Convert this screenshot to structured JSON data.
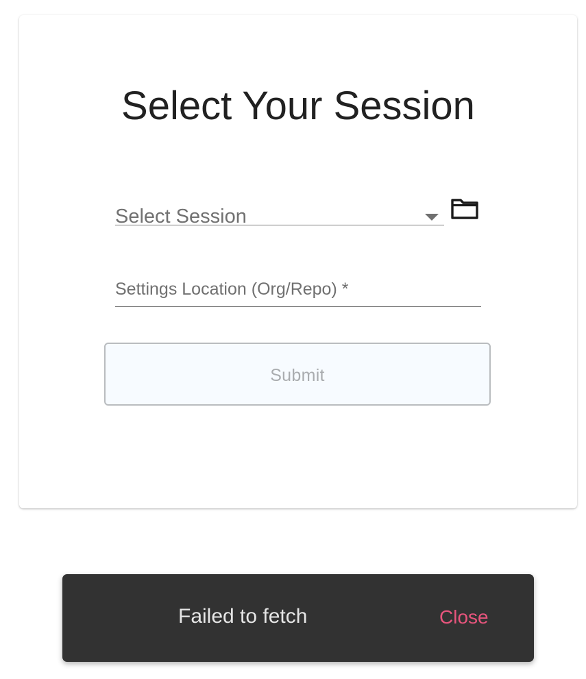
{
  "dialog": {
    "title": "Select Your Session",
    "session_select": {
      "placeholder": "Select Session",
      "icon": "chevron-down-icon"
    },
    "browse_button": {
      "icon": "folder-icon"
    },
    "settings_location": {
      "label": "Settings Location (Org/Repo) *",
      "value": ""
    },
    "submit_label": "Submit"
  },
  "snackbar": {
    "message": "Failed to fetch",
    "action_label": "Close"
  },
  "colors": {
    "snackbar_background": "#323232",
    "action_accent": "#e8557d",
    "submit_background": "#f7fbff",
    "submit_text": "#a9acaf"
  }
}
